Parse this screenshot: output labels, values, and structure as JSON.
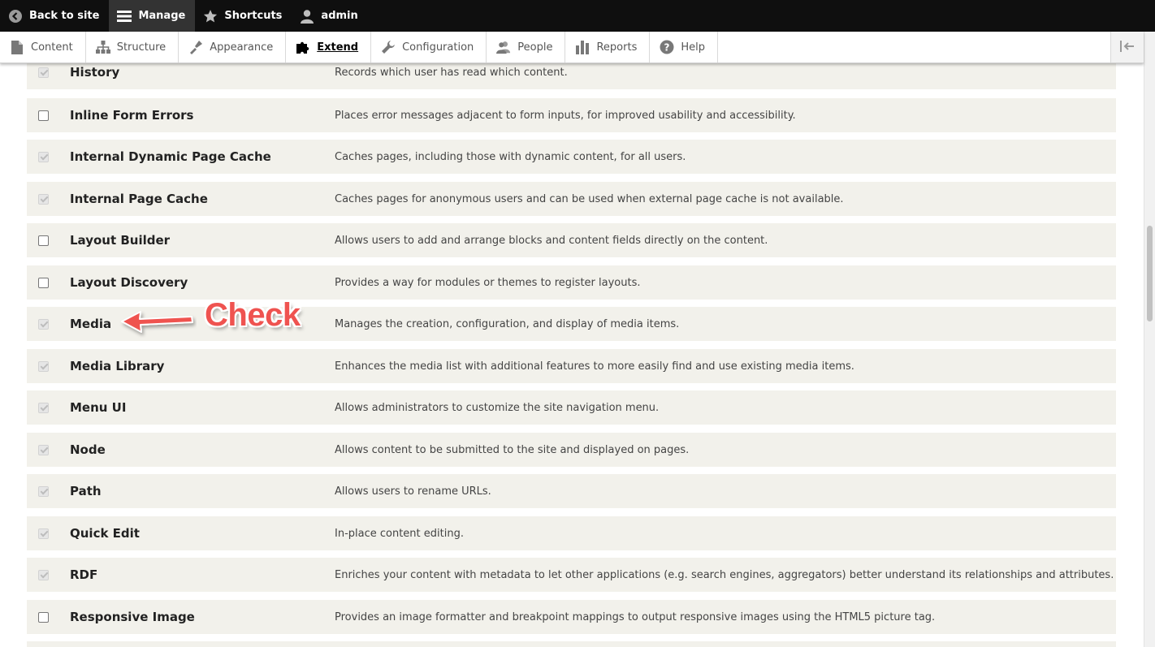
{
  "toolbar": {
    "back": "Back to site",
    "manage": "Manage",
    "shortcuts": "Shortcuts",
    "user": "admin"
  },
  "tray": {
    "items": [
      {
        "label": "Content",
        "icon": "file-icon"
      },
      {
        "label": "Structure",
        "icon": "sitemap-icon"
      },
      {
        "label": "Appearance",
        "icon": "paintbrush-icon"
      },
      {
        "label": "Extend",
        "icon": "puzzle-icon",
        "active": true
      },
      {
        "label": "Configuration",
        "icon": "wrench-icon"
      },
      {
        "label": "People",
        "icon": "people-icon"
      },
      {
        "label": "Reports",
        "icon": "bar-chart-icon"
      },
      {
        "label": "Help",
        "icon": "help-icon"
      }
    ]
  },
  "modules": [
    {
      "name": "History",
      "description": "Records which user has read which content.",
      "checked": true,
      "disabled": true
    },
    {
      "name": "Inline Form Errors",
      "description": "Places error messages adjacent to form inputs, for improved usability and accessibility.",
      "checked": false,
      "disabled": false
    },
    {
      "name": "Internal Dynamic Page Cache",
      "description": "Caches pages, including those with dynamic content, for all users.",
      "checked": true,
      "disabled": true
    },
    {
      "name": "Internal Page Cache",
      "description": "Caches pages for anonymous users and can be used when external page cache is not available.",
      "checked": true,
      "disabled": true
    },
    {
      "name": "Layout Builder",
      "description": "Allows users to add and arrange blocks and content fields directly on the content.",
      "checked": false,
      "disabled": false
    },
    {
      "name": "Layout Discovery",
      "description": "Provides a way for modules or themes to register layouts.",
      "checked": false,
      "disabled": false
    },
    {
      "name": "Media",
      "description": "Manages the creation, configuration, and display of media items.",
      "checked": true,
      "disabled": true
    },
    {
      "name": "Media Library",
      "description": "Enhances the media list with additional features to more easily find and use existing media items.",
      "checked": true,
      "disabled": true
    },
    {
      "name": "Menu UI",
      "description": "Allows administrators to customize the site navigation menu.",
      "checked": true,
      "disabled": true
    },
    {
      "name": "Node",
      "description": "Allows content to be submitted to the site and displayed on pages.",
      "checked": true,
      "disabled": true
    },
    {
      "name": "Path",
      "description": "Allows users to rename URLs.",
      "checked": true,
      "disabled": true
    },
    {
      "name": "Quick Edit",
      "description": "In-place content editing.",
      "checked": true,
      "disabled": true
    },
    {
      "name": "RDF",
      "description": "Enriches your content with metadata to let other applications (e.g. search engines, aggregators) better understand its relationships and attributes.",
      "checked": true,
      "disabled": true
    },
    {
      "name": "Responsive Image",
      "description": "Provides an image formatter and breakpoint mappings to output responsive images using the HTML5 picture tag.",
      "checked": false,
      "disabled": false
    }
  ],
  "annotation": {
    "text": "Check",
    "color": "#ef5350"
  },
  "colors": {
    "toolbar_bg": "#0f0f0f",
    "row_bg": "#f2f1eb"
  }
}
